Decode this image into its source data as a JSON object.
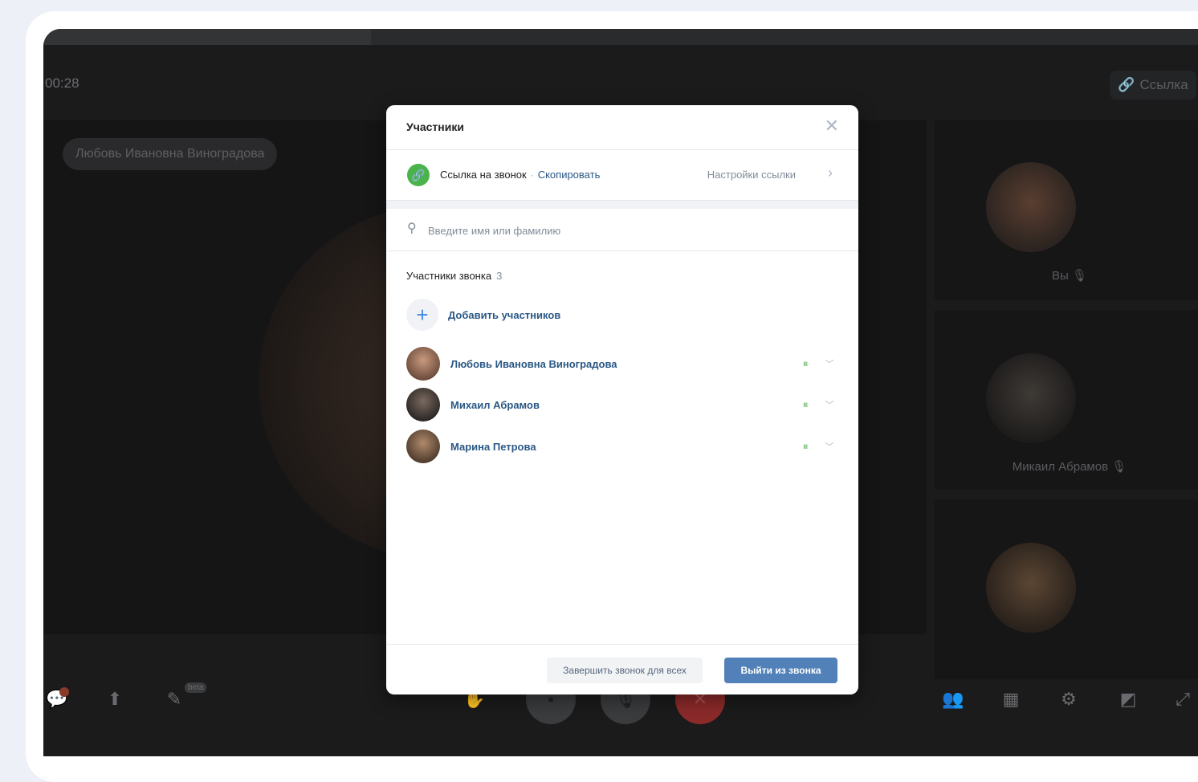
{
  "call": {
    "timer": "00:28",
    "link_button": "Ссылка",
    "main_speaker": "Любовь Ивановна Виноградова",
    "side_labels": {
      "self": "Вы",
      "second": "Микаил Абрамов"
    },
    "beta_label": "beta"
  },
  "modal": {
    "title": "Участники",
    "link": {
      "label": "Ссылка на звонок",
      "separator": "·",
      "copy": "Скопировать",
      "settings": "Настройки ссылки"
    },
    "search": {
      "placeholder": "Введите имя или фамилию"
    },
    "section": {
      "title": "Участники звонка",
      "count": "3"
    },
    "add_label": "Добавить участников",
    "participants": [
      {
        "name": "Любовь Ивановна Виноградова"
      },
      {
        "name": "Михаил Абрамов"
      },
      {
        "name": "Марина Петрова"
      }
    ],
    "footer": {
      "end_for_all": "Завершить звонок для всех",
      "leave": "Выйти из звонка"
    }
  },
  "colors": {
    "accent": "#2a5885",
    "primary_button": "#5181b8",
    "link_icon": "#4bb34b",
    "call_background": "#1b1b1c",
    "end_call": "#8c2a2a"
  },
  "icons": {
    "close": "close-icon",
    "link": "link-icon",
    "search": "search-icon",
    "add": "plus-icon",
    "chevron": "chevron-down-icon",
    "volume": "volume-bars-icon"
  }
}
